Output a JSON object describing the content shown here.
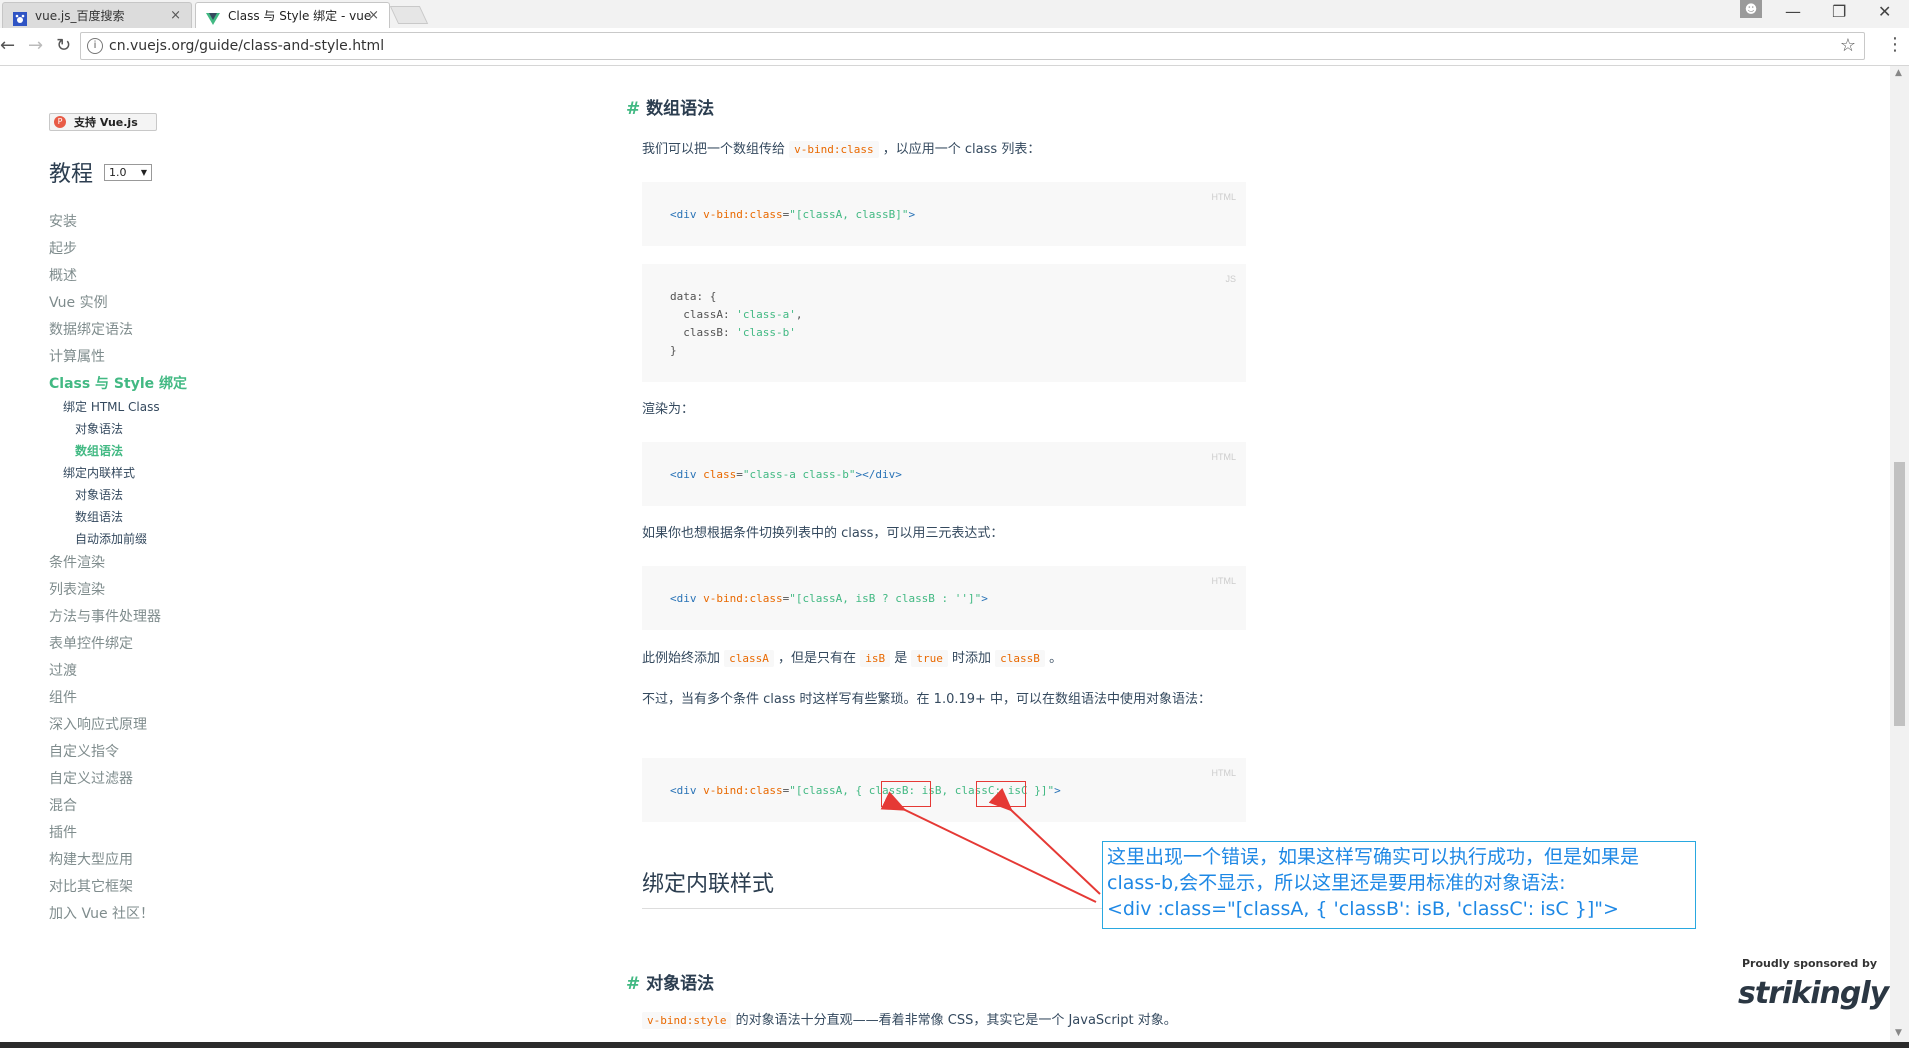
{
  "browser": {
    "tabs": [
      {
        "title": "vue.js_百度搜索",
        "close": "×",
        "icon": "baidu-icon"
      },
      {
        "title": "Class 与 Style 绑定 - vue",
        "close": "×",
        "icon": "vue-logo-icon"
      }
    ],
    "url": "cn.vuejs.org/guide/class-and-style.html",
    "window_controls": {
      "minimize": "—",
      "restore": "❐",
      "close": "✕"
    }
  },
  "sidebar": {
    "support_button": "支持 Vue.js",
    "title": "教程",
    "version": "1.0",
    "items": [
      "安装",
      "起步",
      "概述",
      "Vue 实例",
      "数据绑定语法",
      "计算属性",
      "Class 与 Style 绑定",
      "条件渲染",
      "列表渲染",
      "方法与事件处理器",
      "表单控件绑定",
      "过渡",
      "组件",
      "深入响应式原理",
      "自定义指令",
      "自定义过滤器",
      "混合",
      "插件",
      "构建大型应用",
      "对比其它框架",
      "加入 Vue 社区！"
    ],
    "active_item": "Class 与 Style 绑定",
    "subitems": [
      "绑定 HTML Class",
      "对象语法",
      "数组语法",
      "绑定内联样式",
      "对象语法",
      "数组语法",
      "自动添加前缀"
    ],
    "active_subitem": "数组语法"
  },
  "content": {
    "h_array_syntax": "数组语法",
    "p1_before": "我们可以把一个数组传给",
    "p1_code": "v-bind:class",
    "p1_after": "，以应用一个 class 列表：",
    "code1_lang": "HTML",
    "code2_lang": "JS",
    "p_render": "渲染为：",
    "code3_lang": "HTML",
    "p_ternary": "如果你也想根据条件切换列表中的 class，可以用三元表达式：",
    "code4_lang": "HTML",
    "p5_a": "此例始终添加",
    "p5_code1": "classA",
    "p5_b": "，但是只有在",
    "p5_code2": "isB",
    "p5_c": "是",
    "p5_code3": "true",
    "p5_d": "时添加",
    "p5_code4": "classB",
    "p5_e": "。",
    "p_multi": "不过，当有多个条件 class 时这样写有些繁琐。在 1.0.19+ 中，可以在数组语法中使用对象语法：",
    "code5_lang": "HTML",
    "h2_inline": "绑定内联样式",
    "h_object_syntax": "对象语法",
    "p_last_code": "v-bind:style",
    "p_last": "的对象语法十分直观——看着非常像 CSS，其实它是一个 JavaScript 对象。"
  },
  "annotation": {
    "line1": "这里出现一个错误，如果这样写确实可以执行成功，但是如果是",
    "line2": "class-b,会不显示，所以这里还是要用标准的对象语法:",
    "line3": "<div :class=\"[classA, { 'classB': isB, 'classC': isC }]\">",
    "color": "#1e88e5",
    "arrow_color": "#e53935"
  },
  "sponsor": {
    "label": "Proudly sponsored by",
    "name": "strikingly"
  },
  "colors": {
    "accent": "#42b983",
    "code_attr": "#e96900",
    "code_tag": "#2973b7"
  }
}
